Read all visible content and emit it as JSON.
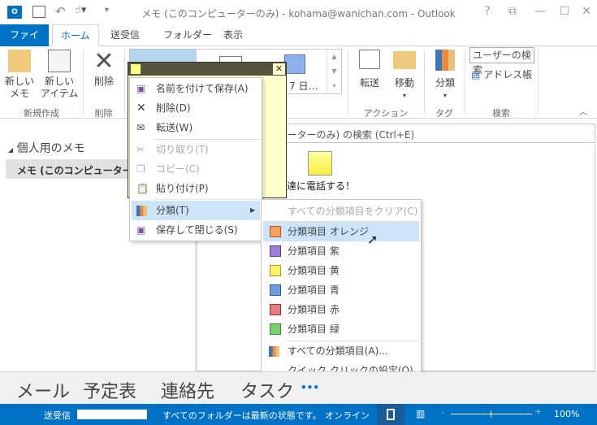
{
  "window": {
    "title": "メモ (このコンピューターのみ) - kohama@wanichan.com - Outlook",
    "help": "?",
    "restore": "⧉",
    "minimize": "—",
    "maximize": "☐",
    "close": "✕"
  },
  "tabs": [
    {
      "label": "ファイル"
    },
    {
      "label": "ホーム"
    },
    {
      "label": "送受信"
    },
    {
      "label": "フォルダー"
    },
    {
      "label": "表示"
    }
  ],
  "ribbon": {
    "new_memo": "新しい\nメモ",
    "new_item": "新しい\nアイテム",
    "delete": "削除",
    "gallery_item": "7 日…",
    "forward": "転送",
    "move": "移動",
    "categorize": "分類",
    "search_people": "ユーザーの検索",
    "address_book": "アドレス帳",
    "groups": {
      "new": "新規作成",
      "delete": "削除",
      "actions": "アクション",
      "tags": "タグ",
      "find": "検索"
    }
  },
  "left_pane": {
    "header": "個人用のメモ",
    "selected_folder": "メモ (このコンピューターのみ)"
  },
  "search": {
    "placeholder": "メモ (このコンピューターのみ) の検索 (Ctrl+E)"
  },
  "content": {
    "notes": [
      {
        "label": "友達に電話する！",
        "color": "#ffff80"
      }
    ]
  },
  "context_menu": {
    "items": [
      {
        "label": "名前を付けて保存(A)",
        "icon": "save-as-icon",
        "enabled": true
      },
      {
        "label": "削除(D)",
        "icon": "delete-icon",
        "enabled": true
      },
      {
        "label": "転送(W)",
        "icon": "forward-icon",
        "enabled": true
      },
      {
        "label": "切り取り(T)",
        "icon": "cut-icon",
        "enabled": false
      },
      {
        "label": "コピー(C)",
        "icon": "copy-icon",
        "enabled": false
      },
      {
        "label": "貼り付け(P)",
        "icon": "paste-icon",
        "enabled": true
      },
      {
        "label": "分類(T)",
        "icon": "categorize-icon",
        "enabled": true,
        "highlighted": true
      },
      {
        "label": "保存して閉じる(S)",
        "icon": "save-close-icon",
        "enabled": true
      }
    ]
  },
  "category_submenu": {
    "items": [
      {
        "label": "すべての分類項目をクリア(C)",
        "enabled": false
      },
      {
        "label": "分類項目 オレンジ",
        "color": "#f4a261",
        "border": "#b5561a",
        "highlighted": true
      },
      {
        "label": "分類項目 紫",
        "color": "#9b7fd4",
        "border": "#5a3d99"
      },
      {
        "label": "分類項目 黄",
        "color": "#faf36a",
        "border": "#a59b1a"
      },
      {
        "label": "分類項目 青",
        "color": "#6e9be0",
        "border": "#2f5a9e"
      },
      {
        "label": "分類項目 赤",
        "color": "#e08080",
        "border": "#a32a2a"
      },
      {
        "label": "分類項目 緑",
        "color": "#7ccf6e",
        "border": "#3a8a2e"
      },
      {
        "label": "すべての分類項目(A)..."
      },
      {
        "label": "クイック クリックの設定(Q)..."
      }
    ]
  },
  "navbar": {
    "items": [
      "メール",
      "予定表",
      "連絡先",
      "タスク"
    ],
    "more": "•••"
  },
  "status": {
    "send_receive": "送受信",
    "message": "すべてのフォルダーは最新の状態です。",
    "connection": "オンライン",
    "zoom": "100%",
    "zoom_percent": 100
  },
  "colors": {
    "accent": "#0072c6",
    "highlight": "#cce4f7",
    "note": "#ffffcc"
  }
}
